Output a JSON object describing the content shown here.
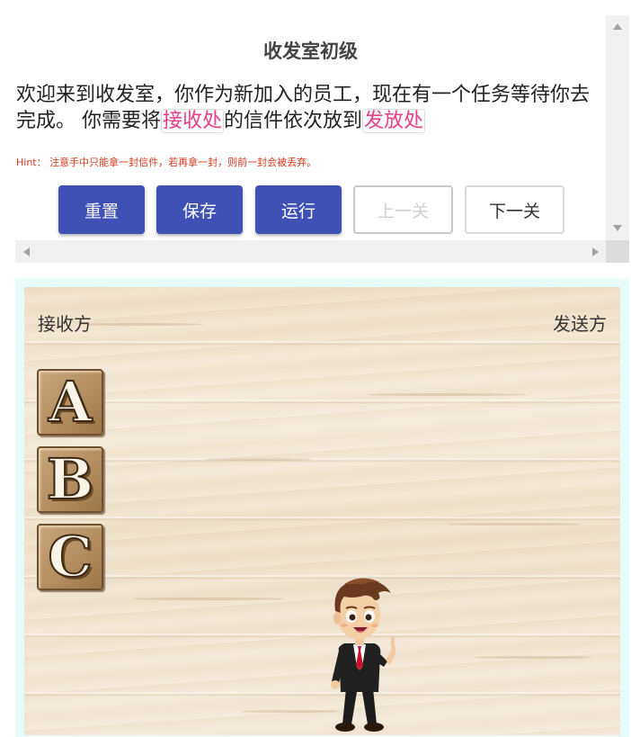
{
  "panel": {
    "title": "收发室初级",
    "description": {
      "part1": "欢迎来到收发室，你作为新加入的员工，现在有一个任务等待你去完成。 你需要将",
      "highlight1": "接收处",
      "part2": "的信件依次放到",
      "highlight2": "发放处"
    },
    "hint": "Hint：  注意手中只能拿一封信件，若再拿一封，则前一封会被丢弃。"
  },
  "buttons": {
    "reset": "重置",
    "save": "保存",
    "run": "运行",
    "prev": "上一关",
    "next": "下一关"
  },
  "colors": {
    "primary_button": "#3f51b5",
    "highlight_text": "#e83e8c",
    "hint_text": "#d9381e"
  },
  "game": {
    "receiver_label": "接收方",
    "sender_label": "发送方",
    "letters": [
      "A",
      "B",
      "C"
    ],
    "character_icon": "office-worker-character"
  }
}
